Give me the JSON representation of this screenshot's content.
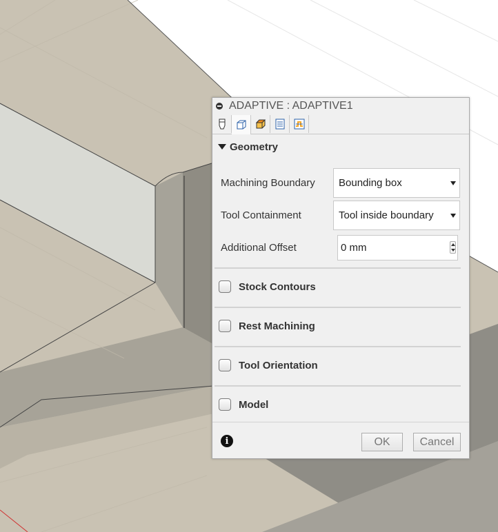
{
  "dialog": {
    "title": "ADAPTIVE : ADAPTIVE1",
    "tabs": [
      {
        "icon": "tool-icon"
      },
      {
        "icon": "geometry-icon"
      },
      {
        "icon": "heights-icon"
      },
      {
        "icon": "passes-icon"
      },
      {
        "icon": "linking-icon"
      }
    ],
    "geometry": {
      "header": "Geometry",
      "machining_boundary": {
        "label": "Machining Boundary",
        "value": "Bounding box"
      },
      "tool_containment": {
        "label": "Tool Containment",
        "value": "Tool inside boundary"
      },
      "additional_offset": {
        "label": "Additional Offset",
        "value": "0 mm"
      }
    },
    "options": [
      {
        "label": "Stock Contours",
        "checked": false
      },
      {
        "label": "Rest Machining",
        "checked": false
      },
      {
        "label": "Tool Orientation",
        "checked": false
      },
      {
        "label": "Model",
        "checked": false
      }
    ],
    "footer": {
      "ok_label": "OK",
      "cancel_label": "Cancel"
    }
  },
  "colors": {
    "dialog_bg": "#f0f0f0",
    "model_top": "#c9c2b3",
    "model_side_light": "#dcdcd6",
    "model_side_dark": "#9d9a91",
    "background": "#ffffff",
    "tab_orange": "#f5a623",
    "tab_blue": "#2a5fa8"
  }
}
